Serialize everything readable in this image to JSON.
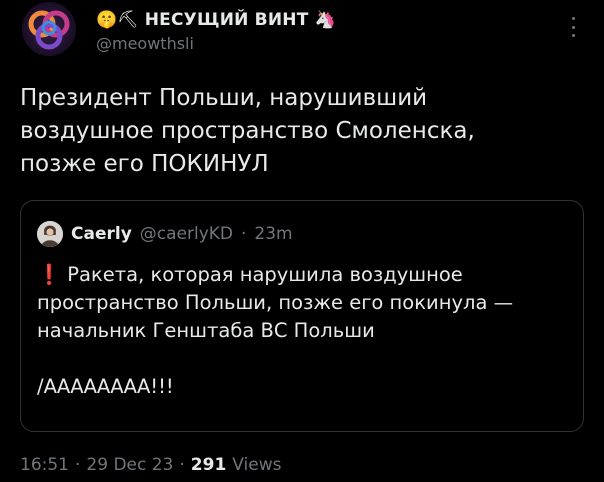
{
  "author": {
    "emoji_prefix": "🤫⛏",
    "display_name": "НЕСУЩИЙ ВИНТ",
    "emoji_suffix": "🦄",
    "handle": "@meowthsli",
    "avatar_icon": "gradient-loop-avatar",
    "more_icon": "more-vertical-icon"
  },
  "post": {
    "lines": [
      "Президент Польши, нарушивший",
      "воздушное пространство Смоленска,",
      "позже его ПОКИНУЛ"
    ]
  },
  "quote": {
    "name": "Caerly",
    "handle": "@caerlyKD",
    "separator": "·",
    "time": "23m",
    "exclamation": "❗",
    "lines": [
      "Ракета, которая нарушила воздушное",
      "пространство Польши, позже его покинула —",
      "начальник Генштаба ВС Польши"
    ],
    "last_line": "/АААААААА!!!",
    "colors": {
      "accent_red": "#e0243a"
    }
  },
  "meta": {
    "time": "16:51",
    "sep1": "·",
    "date": "29 Dec 23",
    "sep2": "·",
    "views_count": "291",
    "views_label": "Views"
  }
}
